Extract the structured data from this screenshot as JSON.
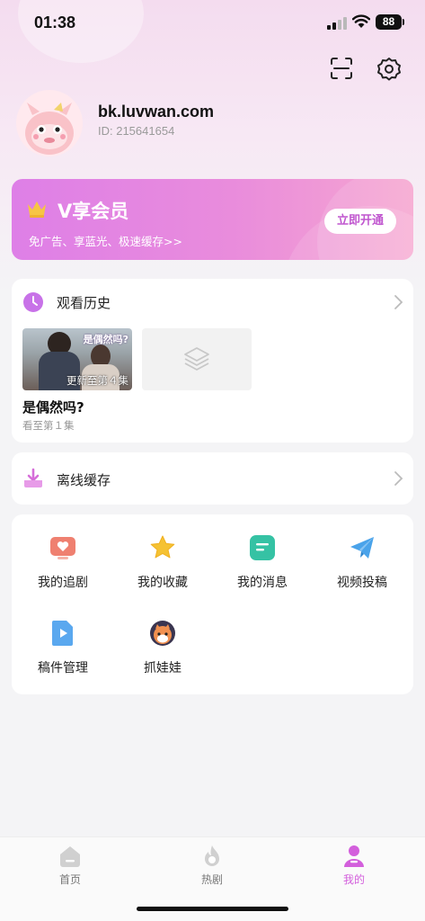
{
  "status_bar": {
    "time": "01:38",
    "battery": "88"
  },
  "header": {
    "icons": [
      "scan-icon",
      "gear-icon"
    ]
  },
  "profile": {
    "username": "bk.luvwan.com",
    "user_id": "ID: 215641654"
  },
  "vip_banner": {
    "title": "V享会员",
    "subtitle": "免广告、享蓝光、极速缓存>>",
    "button_label": "立即开通",
    "colors": {
      "start": "#de7fe7",
      "end": "#f6a6d0",
      "button_text": "#c056cf"
    }
  },
  "watch_history": {
    "title": "观看历史",
    "items": [
      {
        "thumb_title": "是偶然吗?",
        "badge": "更新至第４集",
        "title": "是偶然吗?",
        "progress": "看至第１集"
      },
      {
        "placeholder_icon": "layers-icon"
      }
    ]
  },
  "offline_cache": {
    "title": "离线缓存"
  },
  "features": [
    {
      "label": "我的追剧",
      "icon": "tv-heart-icon",
      "color": "#ef8070"
    },
    {
      "label": "我的收藏",
      "icon": "star-icon",
      "color": "#f5c233"
    },
    {
      "label": "我的消息",
      "icon": "message-icon",
      "color": "#35c2a4"
    },
    {
      "label": "视频投稿",
      "icon": "paper-plane-icon",
      "color": "#4aa3ea"
    },
    {
      "label": "稿件管理",
      "icon": "video-file-icon",
      "color": "#5aa8ef"
    },
    {
      "label": "抓娃娃",
      "icon": "claw-doll-icon",
      "color": "#f09050"
    }
  ],
  "tab_bar": {
    "tabs": [
      {
        "label": "首页",
        "icon": "home-icon",
        "active": false
      },
      {
        "label": "热剧",
        "icon": "flame-icon",
        "active": false
      },
      {
        "label": "我的",
        "icon": "user-icon",
        "active": true
      }
    ],
    "active_color": "#d35fdc"
  }
}
